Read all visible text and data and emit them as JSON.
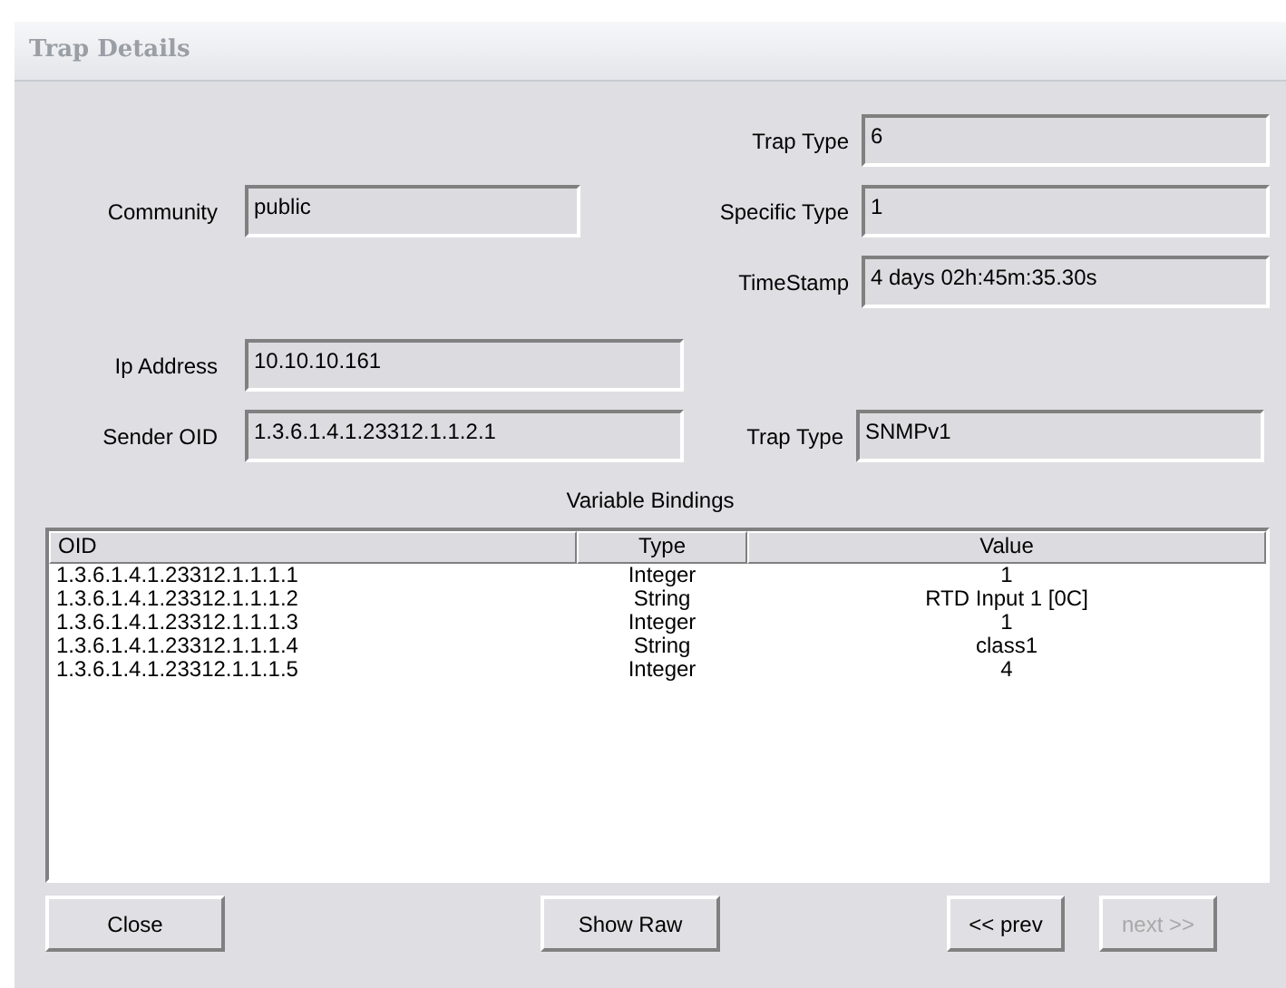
{
  "window": {
    "title": "Trap Details"
  },
  "header_fields": {
    "community": {
      "label": "Community",
      "value": "public"
    },
    "right": [
      {
        "label": "Trap Type",
        "value": "6"
      },
      {
        "label": "Specific Type",
        "value": "1"
      },
      {
        "label": "TimeStamp",
        "value": "4 days 02h:45m:35.30s"
      }
    ]
  },
  "ip_address": {
    "label": "Ip Address",
    "value": "10.10.10.161"
  },
  "sender_oid": {
    "label": "Sender OID",
    "value": "1.3.6.1.4.1.23312.1.1.2.1"
  },
  "trap_version": {
    "label": "Trap Type",
    "value": "SNMPv1"
  },
  "variable_bindings": {
    "title": "Variable Bindings",
    "columns": [
      "OID",
      "Type",
      "Value"
    ],
    "rows": [
      [
        "1.3.6.1.4.1.23312.1.1.1.1",
        "Integer",
        "1"
      ],
      [
        "1.3.6.1.4.1.23312.1.1.1.2",
        "String",
        "RTD Input 1 [0C]"
      ],
      [
        "1.3.6.1.4.1.23312.1.1.1.3",
        "Integer",
        "1"
      ],
      [
        "1.3.6.1.4.1.23312.1.1.1.4",
        "String",
        "class1"
      ],
      [
        "1.3.6.1.4.1.23312.1.1.1.5",
        "Integer",
        "4"
      ]
    ]
  },
  "buttons": [
    {
      "label": "Close",
      "kind": "close",
      "disabled": false
    },
    {
      "label": "Show Raw",
      "kind": "raw",
      "disabled": false
    },
    {
      "label": "<< prev",
      "kind": "prev",
      "disabled": false
    },
    {
      "label": "next >>",
      "kind": "next",
      "disabled": true
    }
  ]
}
